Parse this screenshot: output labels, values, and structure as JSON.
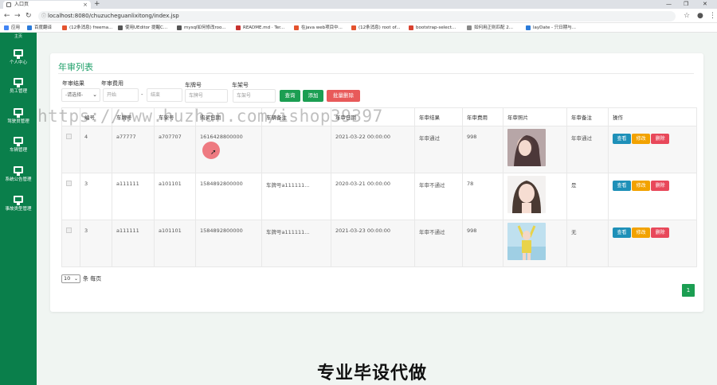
{
  "browser": {
    "tab_title": "入口页",
    "tab_close": "×",
    "new_tab": "+",
    "url": "localhost:8080/chuzucheguanlixitong/index.jsp",
    "window_controls": [
      "—",
      "❐",
      "✕"
    ],
    "bookmarks": [
      {
        "label": "应用",
        "color": "#4285f4"
      },
      {
        "label": "百度翻译",
        "color": "#2b7bd9"
      },
      {
        "label": "(12条消息) freema...",
        "color": "#e4532e"
      },
      {
        "label": "使用UEditor 提醒C...",
        "color": "#555555"
      },
      {
        "label": "mysql如何修改roo...",
        "color": "#555555"
      },
      {
        "label": "README.md · Ter...",
        "color": "#c7322f"
      },
      {
        "label": "在java web项目中...",
        "color": "#e4532e"
      },
      {
        "label": "(12条消息) root of...",
        "color": "#e4532e"
      },
      {
        "label": "bootstrap-select...",
        "color": "#d9412f"
      },
      {
        "label": "如何用正则匹配 2...",
        "color": "#888888"
      },
      {
        "label": "layDate - 只日期与...",
        "color": "#2b7bd9"
      }
    ]
  },
  "sidebar": {
    "top_label": "主页",
    "items": [
      {
        "label": "个人中心"
      },
      {
        "label": "员工管理"
      },
      {
        "label": "驾驶员管理"
      },
      {
        "label": "车辆管理"
      },
      {
        "label": "系统公告管理"
      },
      {
        "label": "事故类型管理"
      }
    ]
  },
  "panel": {
    "title": "年审列表",
    "filters": {
      "result_label": "年审结果",
      "result_selected": "-请选择-",
      "fee_label": "年审费用",
      "fee_start_placeholder": "开始",
      "fee_separator": "-",
      "fee_end_placeholder": "结束",
      "plate_label": "车牌号",
      "plate_placeholder": "车牌号",
      "frame_label": "车架号",
      "frame_placeholder": "车架号"
    },
    "buttons": {
      "search": "查询",
      "add": "添加",
      "batch_delete": "批量删除"
    },
    "table": {
      "columns": [
        "",
        "编号",
        "车牌号",
        "车架号",
        "购买日期",
        "车辆备注",
        "年审日期",
        "年审结果",
        "年审费用",
        "年审照片",
        "年审备注",
        "操作"
      ],
      "rows": [
        {
          "id": "4",
          "plate": "a77777",
          "frame": "a707707",
          "buy_date": "1616428800000",
          "car_note": "",
          "audit_date": "2021-03-22 00:00:00",
          "result": "年审通过",
          "fee": "998",
          "note": "年审通过"
        },
        {
          "id": "3",
          "plate": "a111111",
          "frame": "a101101",
          "buy_date": "1584892800000",
          "car_note": "车牌号a111111...",
          "audit_date": "2020-03-21 00:00:00",
          "result": "年审不通过",
          "fee": "78",
          "note": "是"
        },
        {
          "id": "3",
          "plate": "a111111",
          "frame": "a101101",
          "buy_date": "1584892800000",
          "car_note": "车牌号a111111...",
          "audit_date": "2021-03-23 00:00:00",
          "result": "年审不通过",
          "fee": "998",
          "note": "无"
        }
      ],
      "actions": {
        "view": "查看",
        "edit": "修改",
        "delete": "删除"
      }
    },
    "page_size": "10",
    "page_size_suffix": "条 每页",
    "current_page": "1"
  },
  "overlay": {
    "watermark": "https://www.huzhan.com/ishop39397",
    "promo": "专业毕设代做"
  },
  "colors": {
    "sidebar": "#0a7f4b",
    "accent": "#1b9e52",
    "danger": "#e85a5a"
  }
}
